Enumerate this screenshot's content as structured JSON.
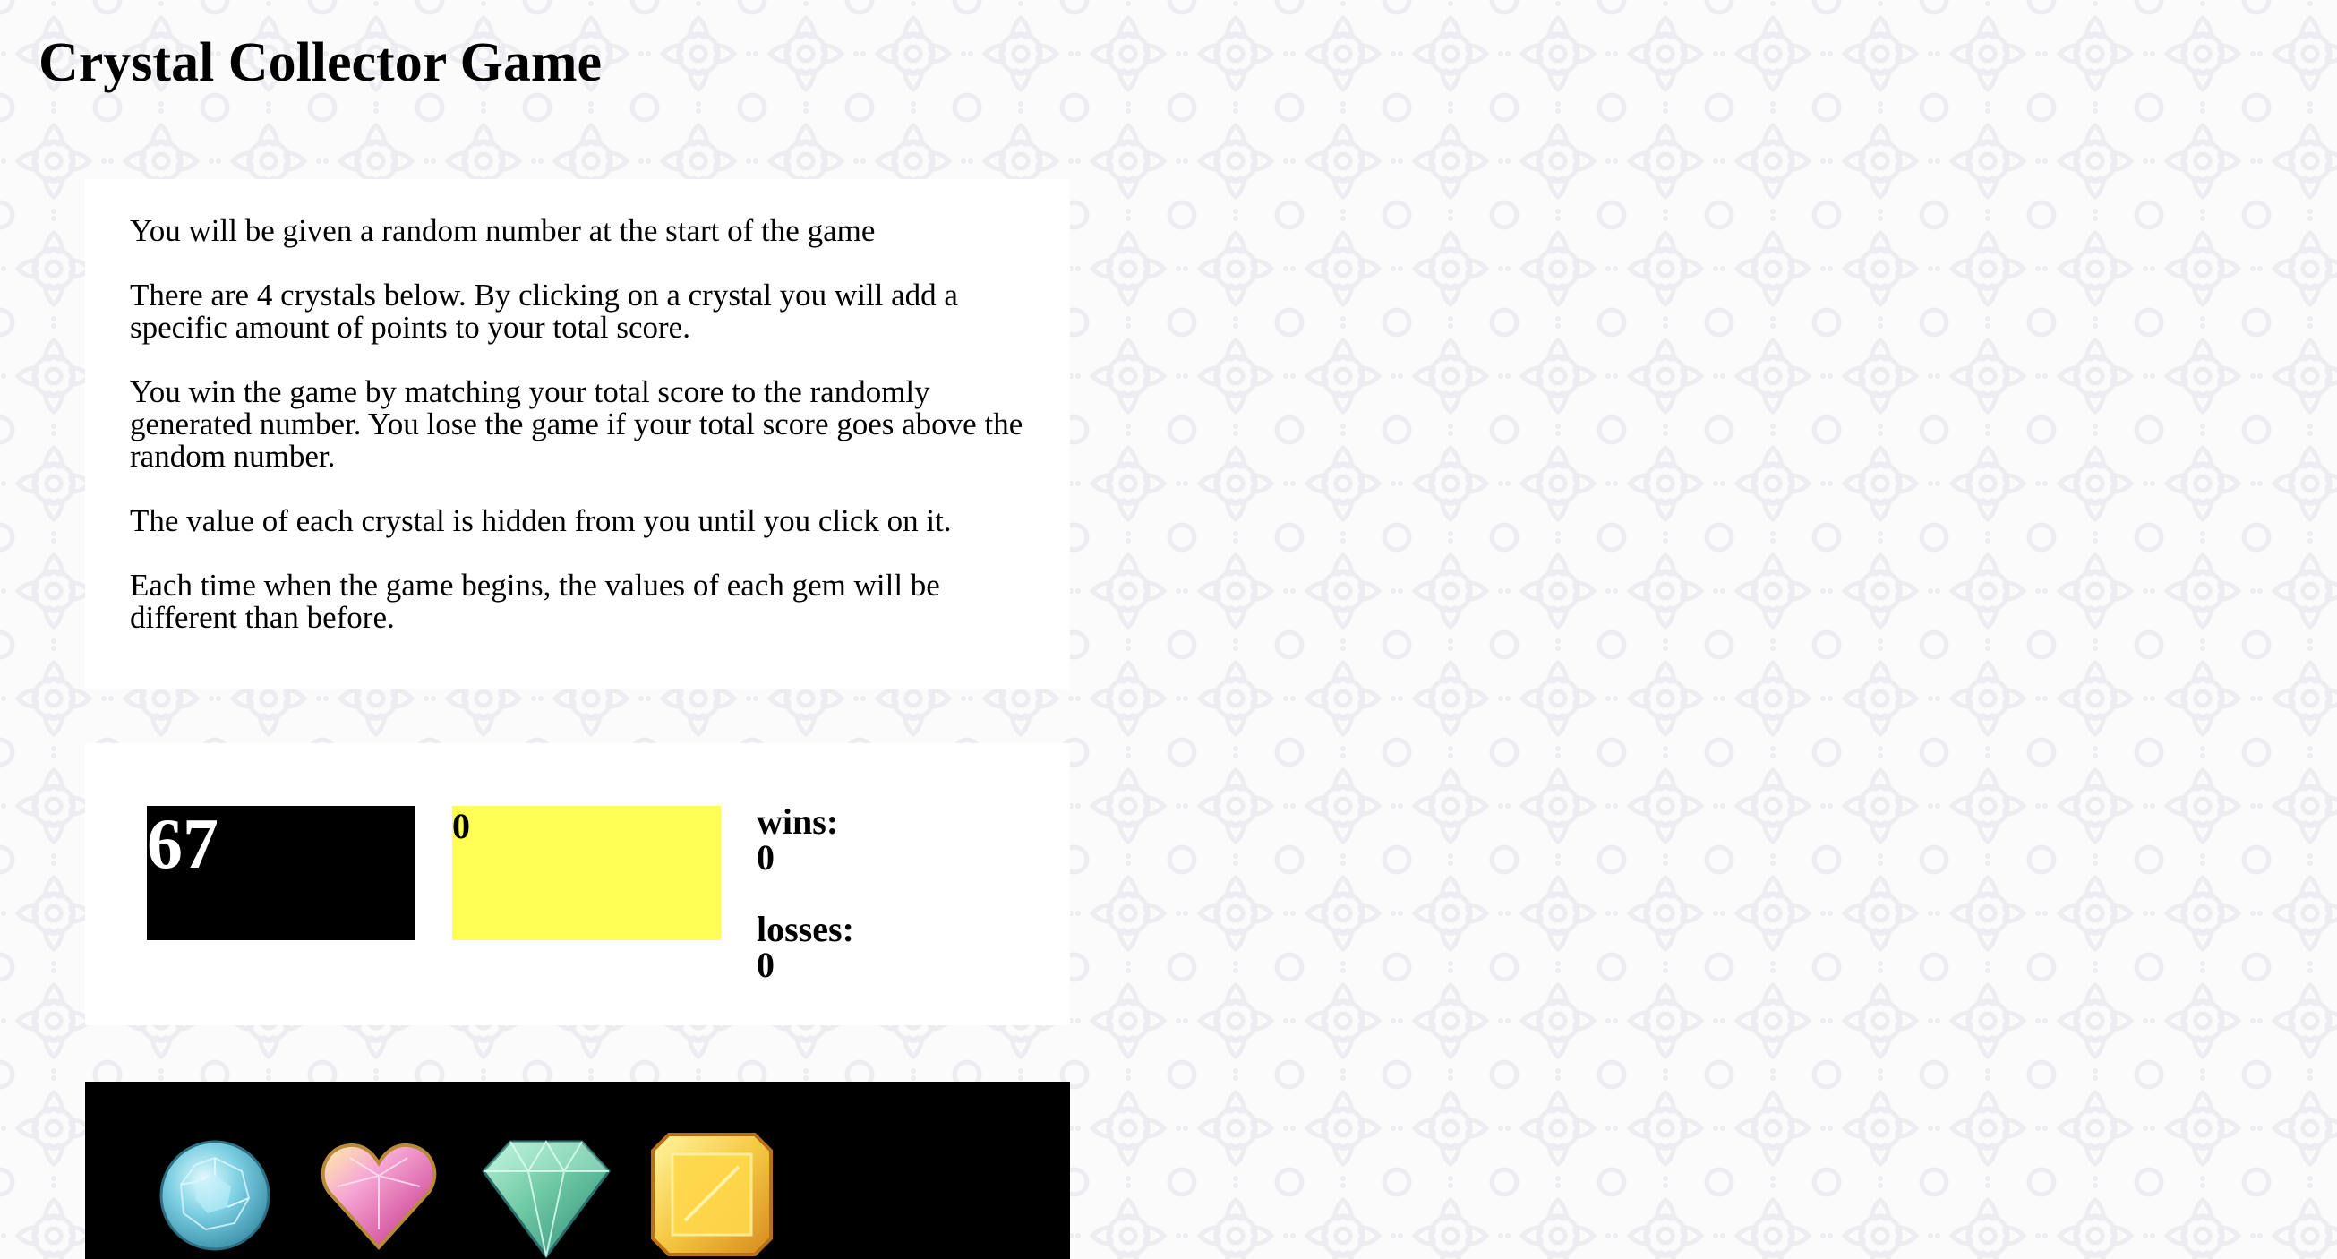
{
  "header": {
    "title": "Crystal Collector Game"
  },
  "instructions": [
    "You will be given a random number at the start of the game",
    "There are 4 crystals below. By clicking on a crystal you will add a specific amount of points to your total score.",
    "You win the game by matching your total score to the randomly generated number. You lose the game if your total score goes above the random number.",
    "The value of each crystal is hidden from you until you click on it.",
    "Each time when the game begins, the values of each gem will be different than before."
  ],
  "scoreboard": {
    "target_number": "67",
    "total_score": "0",
    "wins_label": "wins:",
    "wins_value": "0",
    "losses_label": "losses:",
    "losses_value": "0"
  },
  "crystals": [
    {
      "name": "blue-round-crystal-icon",
      "color": "#6fc3d9"
    },
    {
      "name": "pink-heart-crystal-icon",
      "color": "#e87cb8"
    },
    {
      "name": "green-diamond-crystal-icon",
      "color": "#6fc9a5"
    },
    {
      "name": "yellow-square-crystal-icon",
      "color": "#f5c842"
    }
  ],
  "colors": {
    "target_bg": "#000000",
    "score_bg": "#ffff55",
    "crystal_panel_bg": "#000000",
    "page_bg": "#fbfbfc"
  }
}
